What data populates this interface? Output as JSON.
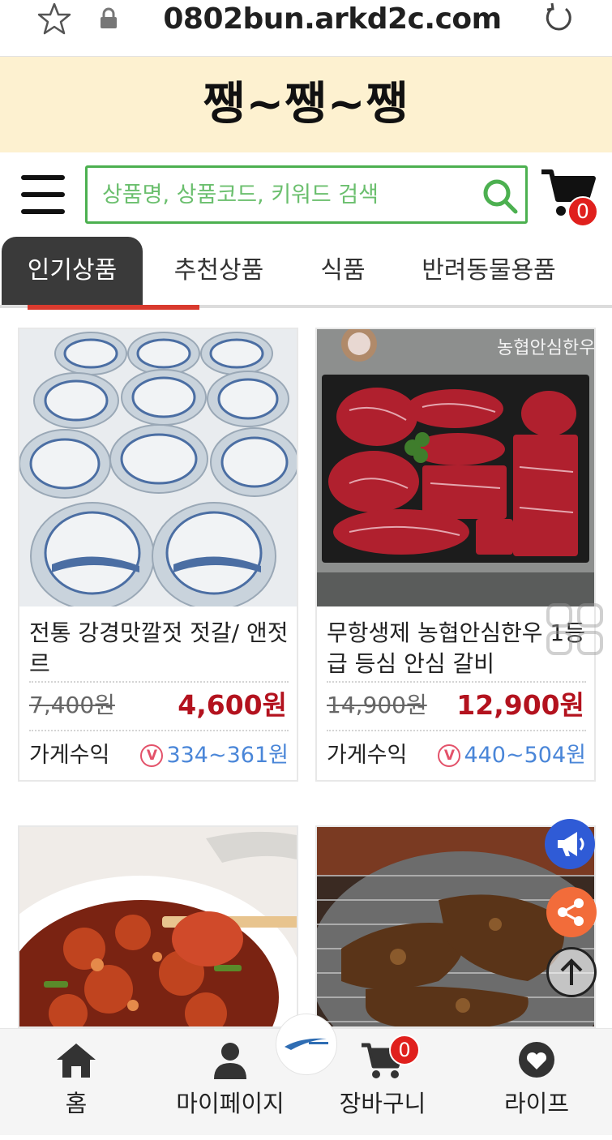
{
  "browser": {
    "url": "0802bun.arkd2c.com"
  },
  "brand": {
    "logo_text": "쨍~쨍~쨍"
  },
  "search": {
    "placeholder": "상품명, 상품코드, 키워드 검색",
    "value": ""
  },
  "cart": {
    "count": "0"
  },
  "tabs": [
    {
      "label": "인기상품",
      "active": true
    },
    {
      "label": "추천상품",
      "active": false
    },
    {
      "label": "식품",
      "active": false
    },
    {
      "label": "반려동물용품",
      "active": false
    }
  ],
  "products": [
    {
      "title": "전통 강경맛깔젓 젓갈/ 앤젓르",
      "original_price": "7,400원",
      "price": "4,600원",
      "earn_label": "가게수익",
      "earn_badge": "V",
      "earn_range": "334~361원"
    },
    {
      "title": "무항생제 농협안심한우 1등급 등심 안심 갈비",
      "original_price": "14,900원",
      "price": "12,900원",
      "earn_label": "가게수익",
      "earn_badge": "V",
      "earn_range": "440~504원"
    }
  ],
  "bottom_nav": [
    {
      "label": "홈",
      "icon": "home-icon"
    },
    {
      "label": "마이페이지",
      "icon": "person-icon"
    },
    {
      "label": "장바구니",
      "icon": "cart-icon",
      "badge": "0"
    },
    {
      "label": "라이프",
      "icon": "heart-icon"
    }
  ],
  "colors": {
    "accent_green": "#4cb050",
    "price_red": "#b3121e",
    "earn_blue": "#4a86d8",
    "tab_active_bg": "#3a3a3a",
    "logo_band_bg": "#fdf1d0"
  }
}
